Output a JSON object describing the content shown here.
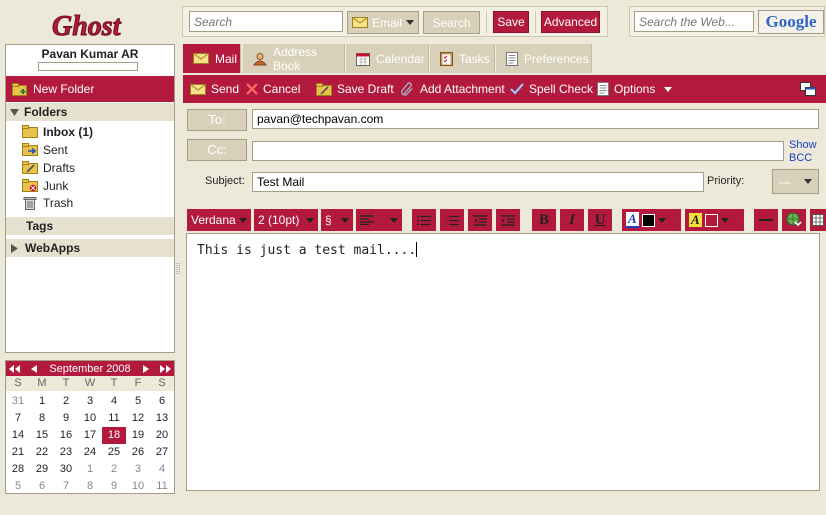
{
  "app": {
    "logo_text": "Ghost"
  },
  "topbar": {
    "search_placeholder": "Search",
    "email_dropdown_label": "Email",
    "search_button": "Search",
    "save_button": "Save",
    "advanced_button": "Advanced",
    "web_search_placeholder": "Search the Web...",
    "google_label": "Google"
  },
  "user": {
    "name": "Pavan Kumar AR"
  },
  "sidebar": {
    "new_folder": "New Folder",
    "folders_header": "Folders",
    "folders": [
      {
        "label": "Inbox (1)",
        "icon": "inbox-icon"
      },
      {
        "label": "Sent",
        "icon": "sent-icon"
      },
      {
        "label": "Drafts",
        "icon": "drafts-icon"
      },
      {
        "label": "Junk",
        "icon": "junk-icon"
      },
      {
        "label": "Trash",
        "icon": "trash-icon"
      }
    ],
    "tags_header": "Tags",
    "webapps_header": "WebApps"
  },
  "calendar": {
    "month_label": "September 2008",
    "weekdays": [
      "S",
      "M",
      "T",
      "W",
      "T",
      "F",
      "S"
    ],
    "weeks": [
      [
        "31",
        "1",
        "2",
        "3",
        "4",
        "5",
        "6"
      ],
      [
        "7",
        "8",
        "9",
        "10",
        "11",
        "12",
        "13"
      ],
      [
        "14",
        "15",
        "16",
        "17",
        "18",
        "19",
        "20"
      ],
      [
        "21",
        "22",
        "23",
        "24",
        "25",
        "26",
        "27"
      ],
      [
        "28",
        "29",
        "30",
        "1",
        "2",
        "3",
        "4"
      ],
      [
        "5",
        "6",
        "7",
        "8",
        "9",
        "10",
        "11"
      ]
    ],
    "today": "18"
  },
  "tabs": [
    "Mail",
    "Address Book",
    "Calendar",
    "Tasks",
    "Preferences"
  ],
  "toolbar": {
    "send": "Send",
    "cancel": "Cancel",
    "save_draft": "Save Draft",
    "add_attachment": "Add Attachment",
    "spell_check": "Spell Check",
    "options": "Options"
  },
  "compose": {
    "to_label": "To:",
    "to_value": "pavan@techpavan.com",
    "cc_label": "Cc:",
    "cc_value": "",
    "show_bcc": "Show BCC",
    "subject_label": "Subject:",
    "subject_value": "Test Mail",
    "priority_label": "Priority:",
    "priority_value": "—",
    "font_value": "Verdana",
    "size_value": "2 (10pt)",
    "style_value": "§",
    "body": "This is just a test mail...."
  }
}
